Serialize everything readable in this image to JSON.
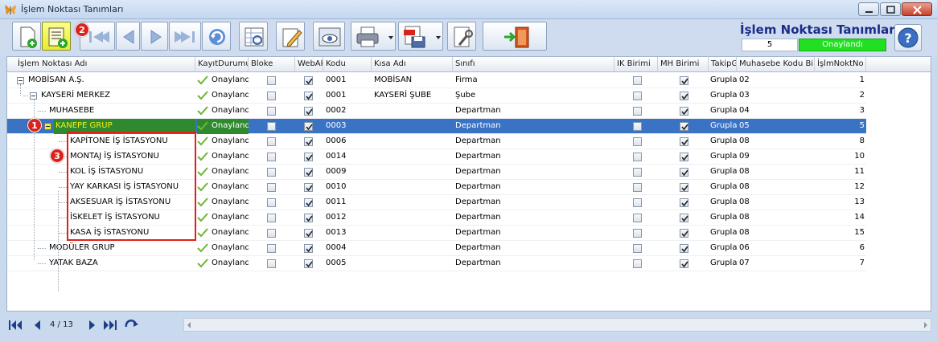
{
  "window": {
    "title": "İşlem Noktası Tanımları"
  },
  "header": {
    "title": "İşlem Noktası Tanımları",
    "record_id": "5",
    "status": "Onaylandı",
    "status_color": "#21e021"
  },
  "toolbar": {
    "buttons": [
      "new-document-icon",
      "add-child-icon",
      "first-record-icon",
      "previous-record-icon",
      "next-record-icon",
      "last-record-icon",
      "refresh-icon",
      "column-chooser-icon",
      "edit-icon",
      "preview-icon",
      "print-icon",
      "export-pdf-icon",
      "settings-icon",
      "exit-icon",
      "help-icon"
    ]
  },
  "callouts": [
    "1",
    "2",
    "3"
  ],
  "grid": {
    "columns": [
      "İşlem Noktası Adı",
      "KayıtDurumu",
      "Bloke",
      "WebAk",
      "Kodu",
      "Kısa Adı",
      "Sınıfı",
      "IK Birimi",
      "MH Birimi",
      "TakipG",
      "Muhasebe Kodu Bile",
      "İşlmNoktNo"
    ],
    "rows": [
      {
        "name": "MOBİSAN A.Ş.",
        "level": 0,
        "expandable": true,
        "status": "Onaylandı",
        "bloke": false,
        "web": true,
        "kodu": "0001",
        "kisa": "MOBİSAN",
        "sinif": "Firma",
        "ik": false,
        "mh": true,
        "takip": "Grupla",
        "muh": "02",
        "no": "1"
      },
      {
        "name": "KAYSERİ MERKEZ",
        "level": 1,
        "expandable": true,
        "status": "Onaylandı",
        "bloke": false,
        "web": true,
        "kodu": "0001",
        "kisa": "KAYSERİ ŞUBE",
        "sinif": "Şube",
        "ik": false,
        "mh": true,
        "takip": "Grupla",
        "muh": "03",
        "no": "2"
      },
      {
        "name": "MUHASEBE",
        "level": 2,
        "expandable": false,
        "status": "Onaylandı",
        "bloke": false,
        "web": true,
        "kodu": "0002",
        "kisa": "",
        "sinif": "Departman",
        "ik": false,
        "mh": true,
        "takip": "Grupla",
        "muh": "04",
        "no": "3"
      },
      {
        "name": "KANEPE GRUP",
        "level": 2,
        "expandable": true,
        "selected": true,
        "status": "Onaylandı",
        "bloke": false,
        "web": true,
        "kodu": "0003",
        "kisa": "",
        "sinif": "Departman",
        "ik": false,
        "mh": true,
        "takip": "Grupla",
        "muh": "05",
        "no": "5"
      },
      {
        "name": "KAPİTONE İŞ İSTASYONU",
        "level": 3,
        "expandable": false,
        "status": "Onaylandı",
        "bloke": false,
        "web": true,
        "kodu": "0006",
        "kisa": "",
        "sinif": "Departman",
        "ik": false,
        "mh": true,
        "takip": "Grupla",
        "muh": "08",
        "no": "8"
      },
      {
        "name": "MONTAJ İŞ İSTASYONU",
        "level": 3,
        "expandable": false,
        "status": "Onaylandı",
        "bloke": false,
        "web": true,
        "kodu": "0014",
        "kisa": "",
        "sinif": "Departman",
        "ik": false,
        "mh": true,
        "takip": "Grupla",
        "muh": "09",
        "no": "10"
      },
      {
        "name": "KOL İŞ İSTASYONU",
        "level": 3,
        "expandable": false,
        "status": "Onaylandı",
        "bloke": false,
        "web": true,
        "kodu": "0009",
        "kisa": "",
        "sinif": "Departman",
        "ik": false,
        "mh": true,
        "takip": "Grupla",
        "muh": "08",
        "no": "11"
      },
      {
        "name": "YAY KARKASI İŞ İSTASYONU",
        "level": 3,
        "expandable": false,
        "status": "Onaylandı",
        "bloke": false,
        "web": true,
        "kodu": "0010",
        "kisa": "",
        "sinif": "Departman",
        "ik": false,
        "mh": true,
        "takip": "Grupla",
        "muh": "08",
        "no": "12"
      },
      {
        "name": "AKSESUAR İŞ İSTASYONU",
        "level": 3,
        "expandable": false,
        "status": "Onaylandı",
        "bloke": false,
        "web": true,
        "kodu": "0011",
        "kisa": "",
        "sinif": "Departman",
        "ik": false,
        "mh": true,
        "takip": "Grupla",
        "muh": "08",
        "no": "13"
      },
      {
        "name": "İSKELET İŞ İSTASYONU",
        "level": 3,
        "expandable": false,
        "status": "Onaylandı",
        "bloke": false,
        "web": true,
        "kodu": "0012",
        "kisa": "",
        "sinif": "Departman",
        "ik": false,
        "mh": true,
        "takip": "Grupla",
        "muh": "08",
        "no": "14"
      },
      {
        "name": "KASA İŞ İSTASYONU",
        "level": 3,
        "expandable": false,
        "status": "Onaylandı",
        "bloke": false,
        "web": true,
        "kodu": "0013",
        "kisa": "",
        "sinif": "Departman",
        "ik": false,
        "mh": true,
        "takip": "Grupla",
        "muh": "08",
        "no": "15"
      },
      {
        "name": "MODÜLER GRUP",
        "level": 2,
        "expandable": false,
        "status": "Onaylandı",
        "bloke": false,
        "web": true,
        "kodu": "0004",
        "kisa": "",
        "sinif": "Departman",
        "ik": false,
        "mh": true,
        "takip": "Grupla",
        "muh": "06",
        "no": "6"
      },
      {
        "name": "YATAK BAZA",
        "level": 2,
        "expandable": false,
        "status": "Onaylandı",
        "bloke": false,
        "web": true,
        "kodu": "0005",
        "kisa": "",
        "sinif": "Departman",
        "ik": false,
        "mh": true,
        "takip": "Grupla",
        "muh": "07",
        "no": "7"
      }
    ]
  },
  "footer": {
    "page_label": "4 / 13"
  }
}
